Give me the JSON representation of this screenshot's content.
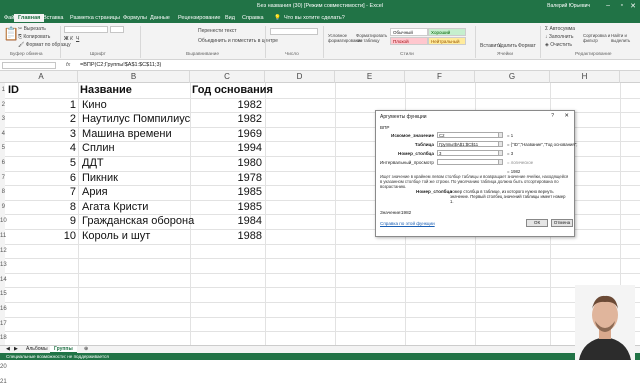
{
  "window": {
    "title": "Без названия (30)  [Режим совместимости]  -  Excel",
    "user": "Валерий Юрьевич"
  },
  "menu": {
    "tabs": [
      "Файл",
      "Главная",
      "Вставка",
      "Разметка страницы",
      "Формулы",
      "Данные",
      "Рецензирование",
      "Вид",
      "Справка"
    ],
    "search": "Что вы хотите сделать?"
  },
  "ribbon": {
    "cut": "Вырезать",
    "copy": "Копировать",
    "format_painter": "Формат по образцу",
    "clipboard": "Буфер обмена",
    "font": "Шрифт",
    "wrap": "Перенести текст",
    "merge": "Объединить и поместить в центре",
    "alignment": "Выравнивание",
    "number": "Число",
    "cond_format": "Условное форматирование",
    "format_table": "Форматировать как таблицу",
    "style_normal": "Обычный",
    "style_good": "Хороший",
    "style_bad": "Плохой",
    "style_neutral": "Нейтральный",
    "styles": "Стили",
    "insert": "Вставить",
    "delete": "Удалить",
    "format": "Формат",
    "cells": "Ячейки",
    "autosum": "Автосумма",
    "fill": "Заполнить",
    "clear": "Очистить",
    "sort": "Сортировка и фильтр",
    "find": "Найти и выделить",
    "editing": "Редактирование"
  },
  "formula_bar": {
    "fx": "fx",
    "formula": "=ВПР(C2;Группы!$A$1:$C$11;3)"
  },
  "columns": [
    "A",
    "B",
    "C",
    "D",
    "E",
    "F",
    "G",
    "H"
  ],
  "rows": [
    "1",
    "2",
    "3",
    "4",
    "5",
    "6",
    "7",
    "8",
    "9",
    "10",
    "11",
    "12",
    "13",
    "14",
    "15",
    "16",
    "17",
    "18",
    "19",
    "20",
    "21"
  ],
  "table": {
    "headers": [
      "ID",
      "Название",
      "Год основания"
    ],
    "rows": [
      [
        "1",
        "Кино",
        "1982"
      ],
      [
        "2",
        "Наутилус Помпилиус",
        "1982"
      ],
      [
        "3",
        "Машина времени",
        "1969"
      ],
      [
        "4",
        "Сплин",
        "1994"
      ],
      [
        "5",
        "ДДТ",
        "1980"
      ],
      [
        "6",
        "Пикник",
        "1978"
      ],
      [
        "7",
        "Ария",
        "1985"
      ],
      [
        "8",
        "Агата Кристи",
        "1985"
      ],
      [
        "9",
        "Гражданская оборона",
        "1984"
      ],
      [
        "10",
        "Король и шут",
        "1988"
      ]
    ]
  },
  "dialog": {
    "title": "Аргументы функции",
    "help": "?",
    "close": "✕",
    "function": "ВПР",
    "args": [
      {
        "label": "Искомое_значение",
        "value": "C2",
        "result": "= 1"
      },
      {
        "label": "Таблица",
        "value": "Группы!$A$1:$C$11",
        "result": "= {\"ID\",\"Название\",\"Год основания\";"
      },
      {
        "label": "Номер_столбца",
        "value": "3",
        "result": "= 3"
      },
      {
        "label": "Интервальный_просмотр",
        "value": "",
        "result": "= логическое"
      }
    ],
    "total": "= 1982",
    "description": "Ищет значение в крайнем левом столбце таблицы и возвращает значение ячейки, находящейся в указанном столбце той же строки. По умолчанию таблица должна быть отсортирована по возрастанию.",
    "arg_name": "Номер_столбца",
    "arg_desc": "номер столбца в таблице, из которого нужно вернуть значение. Первый столбец значений таблицы имеет номер 1.",
    "value_label": "Значение:",
    "value": "1982",
    "help_link": "Справка по этой функции",
    "ok": "ОК",
    "cancel": "Отмена"
  },
  "sheets": [
    "Альбомы",
    "Группы"
  ],
  "status": "Специальные возможности: не поддерживается"
}
